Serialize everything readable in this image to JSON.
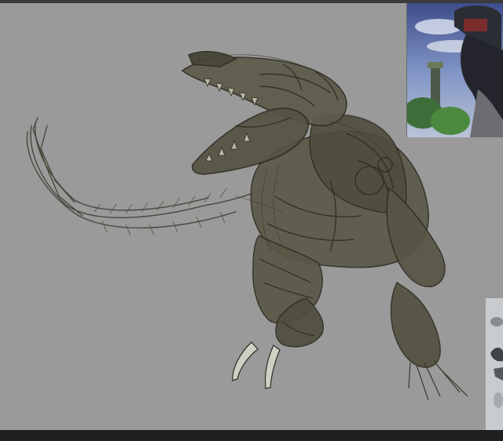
{
  "app": {
    "canvas_background": "#9a9a9a",
    "sketch_color": "#4f4d3d",
    "sketch_stroke": "#2e2c22"
  },
  "reference_images": [
    {
      "name": "castle-landscape-reference"
    },
    {
      "name": "creature-reference"
    }
  ]
}
